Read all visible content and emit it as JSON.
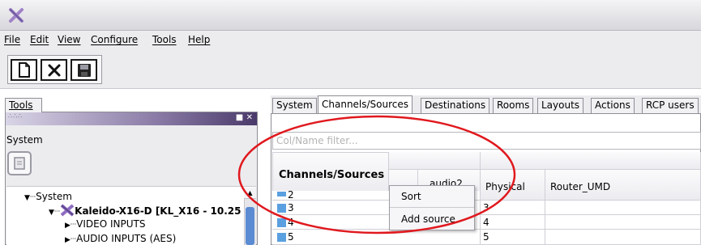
{
  "menubar": {
    "items": [
      {
        "label": "File"
      },
      {
        "label": "Edit"
      },
      {
        "label": "View"
      },
      {
        "label": "Configure"
      },
      {
        "label": "Tools"
      },
      {
        "label": "Help"
      }
    ]
  },
  "toolbar": {
    "buttons": [
      "new-document-icon",
      "close-x-icon",
      "save-disk-icon"
    ]
  },
  "left_panel": {
    "tab_label": "Tools",
    "section_label": "System",
    "tree": [
      {
        "label": "System",
        "level": 0
      },
      {
        "label": "Kaleido-X16-D [KL_X16 - 10.25",
        "level": 1
      },
      {
        "label": "VIDEO INPUTS",
        "level": 2
      },
      {
        "label": "AUDIO INPUTS (AES)",
        "level": 2
      }
    ]
  },
  "right_panel": {
    "tabs": [
      {
        "label": "System"
      },
      {
        "label": "Channels/Sources",
        "active": true
      },
      {
        "label": "Destinations"
      },
      {
        "label": "Rooms"
      },
      {
        "label": "Layouts"
      },
      {
        "label": "Actions"
      },
      {
        "label": "RCP users"
      }
    ],
    "filter_placeholder": "Col/Name filter...",
    "table": {
      "header_main": "Channels/Sources",
      "columns": [
        "",
        "audio2",
        "Physical",
        "Router_UMD"
      ],
      "rows": [
        {
          "id": "2",
          "physical": ""
        },
        {
          "id": "3",
          "physical": "3"
        },
        {
          "id": "4",
          "physical": "4"
        },
        {
          "id": "5",
          "physical": "5"
        }
      ]
    }
  },
  "context_menu": {
    "items": [
      {
        "label": "Sort"
      },
      {
        "label": "Add source"
      }
    ]
  },
  "colors": {
    "annotation_ellipse": "#e0191e",
    "row_chip": "#5aa0e0",
    "scroll_thumb": "#5b8bd3"
  }
}
